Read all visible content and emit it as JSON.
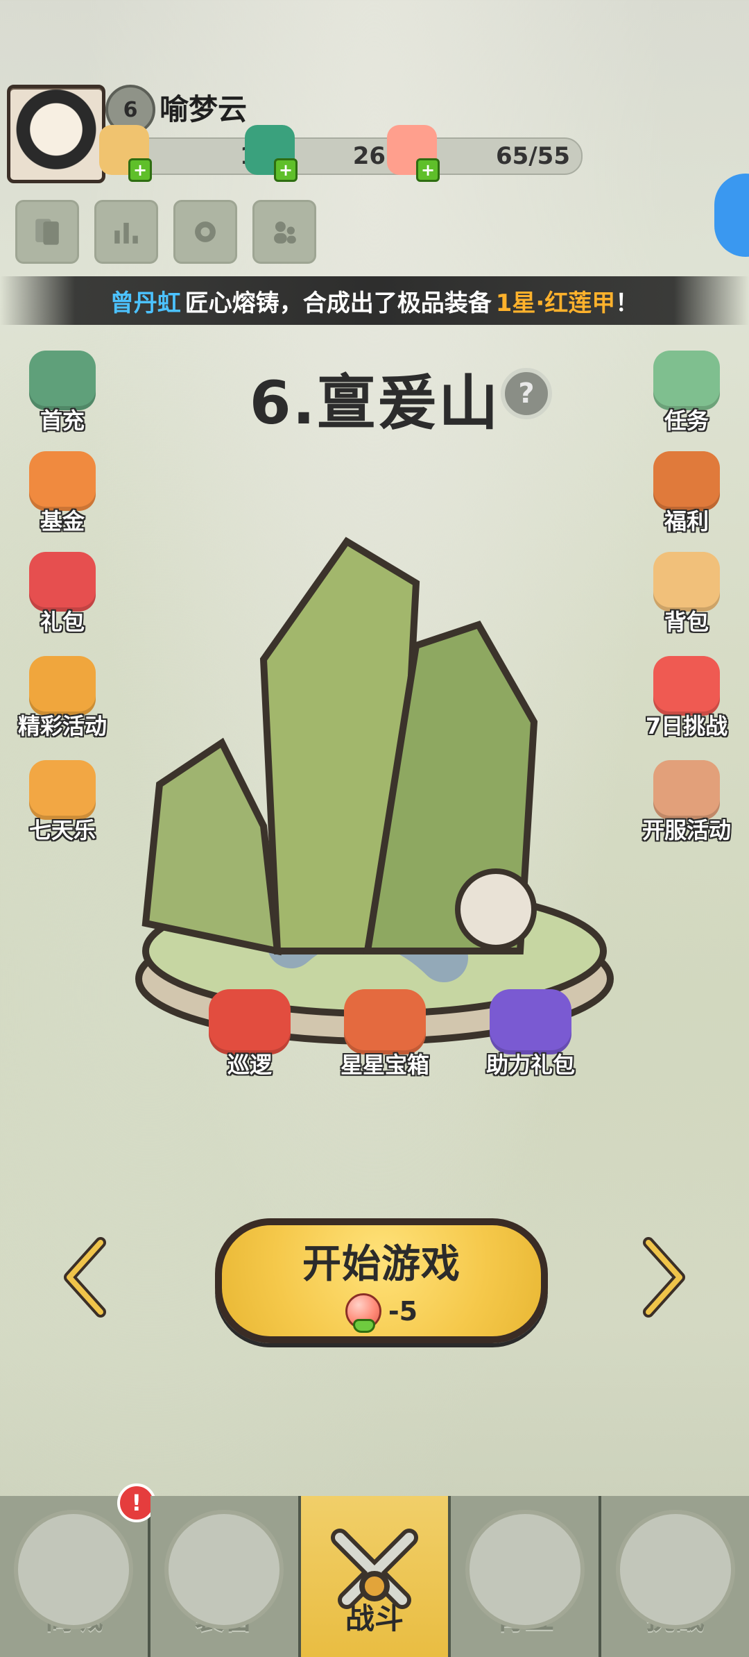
{
  "profile": {
    "level": "6",
    "name": "喻梦云"
  },
  "resources": {
    "tickets": "142",
    "jade": "26502",
    "stamina": "65/55"
  },
  "marquee": {
    "player": "曾丹虹",
    "message": "匠心熔铸，合成出了极品装备",
    "item": "1星·红莲甲",
    "suffix": "！"
  },
  "stage": {
    "title": "6.亶爰山",
    "help": "?"
  },
  "left_menu": [
    {
      "label": "首充"
    },
    {
      "label": "基金"
    },
    {
      "label": "礼包"
    },
    {
      "label": "精彩活动"
    },
    {
      "label": "七天乐"
    }
  ],
  "right_menu": [
    {
      "label": "任务"
    },
    {
      "label": "福利"
    },
    {
      "label": "背包"
    },
    {
      "label": "7日挑战"
    },
    {
      "label": "开服活动"
    }
  ],
  "actions": [
    {
      "label": "巡逻"
    },
    {
      "label": "星星宝箱"
    },
    {
      "label": "助力礼包"
    }
  ],
  "start": {
    "label": "开始游戏",
    "cost": "-5"
  },
  "nav": {
    "tabs": [
      {
        "label": "商城",
        "badge": "!"
      },
      {
        "label": "装备"
      },
      {
        "label": "战斗"
      },
      {
        "label": "青丘"
      },
      {
        "label": "挑战"
      }
    ]
  },
  "colors": {
    "accent_blue": "#4cc2ff",
    "accent_orange": "#ffb22c",
    "start_button": "#f5c84a",
    "nav_active": "#e9bd42"
  }
}
